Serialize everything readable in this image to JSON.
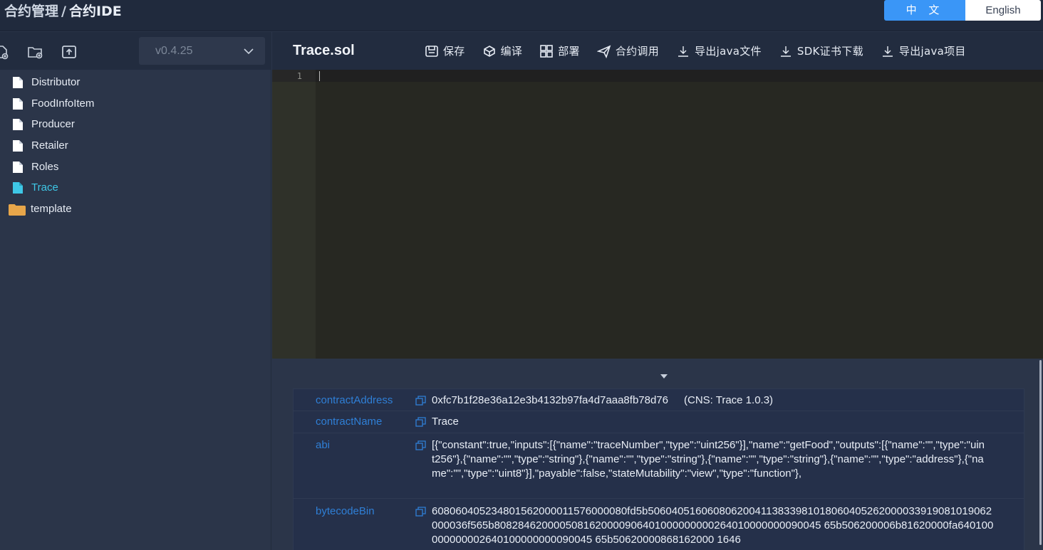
{
  "header": {
    "breadcrumb_root": "合约管理",
    "breadcrumb_sep": "/",
    "breadcrumb_current": "合约IDE",
    "lang_cn": "中 文",
    "lang_en": "English"
  },
  "sidebar": {
    "tools": [
      "new-file-icon",
      "new-folder-icon",
      "upload-icon"
    ],
    "version": "v0.4.25",
    "files": [
      {
        "name": "Distributor",
        "type": "file",
        "active": false
      },
      {
        "name": "FoodInfoItem",
        "type": "file",
        "active": false
      },
      {
        "name": "Producer",
        "type": "file",
        "active": false
      },
      {
        "name": "Retailer",
        "type": "file",
        "active": false
      },
      {
        "name": "Roles",
        "type": "file",
        "active": false
      },
      {
        "name": "Trace",
        "type": "file",
        "active": true
      },
      {
        "name": "template",
        "type": "folder",
        "active": false
      }
    ]
  },
  "editor": {
    "file_title": "Trace.sol",
    "actions": [
      {
        "label": "保存",
        "icon": "save-icon"
      },
      {
        "label": "编译",
        "icon": "compile-icon"
      },
      {
        "label": "部署",
        "icon": "deploy-icon"
      },
      {
        "label": "合约调用",
        "icon": "send-icon"
      },
      {
        "label": "导出java文件",
        "icon": "download-icon"
      },
      {
        "label": "SDK证书下载",
        "icon": "download-icon"
      },
      {
        "label": "导出java项目",
        "icon": "download-icon"
      }
    ],
    "line_numbers": [
      "1"
    ]
  },
  "result": {
    "contract_address_key": "contractAddress",
    "contract_address_value": "0xfc7b1f28e36a12e3b4132b97fa4d7aaa8fb78d76",
    "cns": "(CNS: Trace 1.0.3)",
    "contract_name_key": "contractName",
    "contract_name_value": "Trace",
    "abi_key": "abi",
    "abi_value": "[{\"constant\":true,\"inputs\":[{\"name\":\"traceNumber\",\"type\":\"uint256\"}],\"name\":\"getFood\",\"outputs\":[{\"name\":\"\",\"type\":\"uint256\"},{\"name\":\"\",\"type\":\"string\"},{\"name\":\"\",\"type\":\"string\"},{\"name\":\"\",\"type\":\"string\"},{\"name\":\"\",\"type\":\"address\"},{\"name\":\"\",\"type\":\"uint8\"}],\"payable\":false,\"stateMutability\":\"view\",\"type\":\"function\"},",
    "bytecode_key": "bytecodeBin",
    "bytecode_value": "608060405234801562000011576000080fd5b5060405160608062004113833981018060405262000033919081019062000036f565b8082846200005081620000906401000000000264010000000090045 65b506200006b81620000fa640100000000002640100000000090045 65b50620000868162000 1646"
  },
  "colors": {
    "accent": "#3a96f7",
    "active_file": "#3ec7e6",
    "key_text": "#2f7fd6"
  }
}
